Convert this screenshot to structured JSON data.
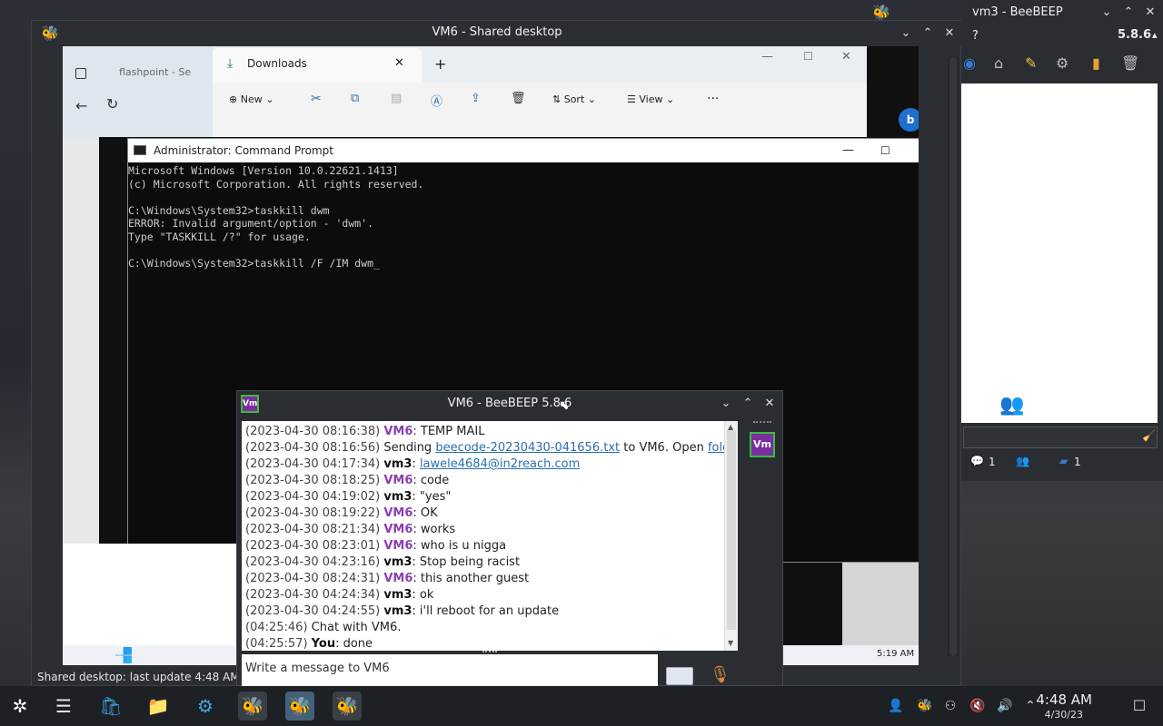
{
  "shared_desktop": {
    "title": "VM6 - Shared desktop",
    "status": "Shared desktop: last update 4:48 AM"
  },
  "remote": {
    "downloads_tab": "Downloads",
    "behind_tab": "flashpoint - Se",
    "toolbar": {
      "new": "New",
      "sort": "Sort",
      "view": "View"
    },
    "cmd_title": "Administrator: Command Prompt",
    "cmd_lines": [
      "Microsoft Windows [Version 10.0.22621.1413]",
      "(c) Microsoft Corporation. All rights reserved.",
      "",
      "C:\\Windows\\System32>taskkill dwm",
      "ERROR: Invalid argument/option - 'dwm'.",
      "Type \"TASKKILL /?\" for usage.",
      "",
      "C:\\Windows\\System32>taskkill /F /IM dwm_"
    ],
    "clock": "5:19 AM"
  },
  "chat": {
    "title": "VM6 - BeeBEEP 5.8.6",
    "badge": "Vm",
    "input_placeholder": "Write a message to VM6",
    "messages": [
      {
        "ts": "(2023-04-30 08:16:38)",
        "who": "VM6",
        "text": ": TEMP MAIL"
      },
      {
        "ts": "(2023-04-30 08:16:56)",
        "who": "",
        "text": " Sending ",
        "link": "beecode-20230430-041656.txt",
        "after": " to VM6. Open ",
        "link2": "folder",
        "tail": "."
      },
      {
        "ts": "(2023-04-30 04:17:34)",
        "who": "vm3",
        "text": ": ",
        "link": "lawele4684@in2reach.com"
      },
      {
        "ts": "(2023-04-30 08:18:25)",
        "who": "VM6",
        "text": ": code"
      },
      {
        "ts": "(2023-04-30 04:19:02)",
        "who": "vm3",
        "text": ": \"yes\""
      },
      {
        "ts": "(2023-04-30 08:19:22)",
        "who": "VM6",
        "text": ": OK"
      },
      {
        "ts": "(2023-04-30 08:21:34)",
        "who": "VM6",
        "text": ": works"
      },
      {
        "ts": "(2023-04-30 08:23:01)",
        "who": "VM6",
        "text": ": who is u nigga"
      },
      {
        "ts": "(2023-04-30 04:23:16)",
        "who": "vm3",
        "text": ": Stop being racist"
      },
      {
        "ts": "(2023-04-30 08:24:31)",
        "who": "VM6",
        "text": ": this another guest"
      },
      {
        "ts": "(2023-04-30 04:24:34)",
        "who": "vm3",
        "text": ": ok"
      },
      {
        "ts": "(2023-04-30 04:24:55)",
        "who": "vm3",
        "text": ": i'll reboot for an update"
      },
      {
        "ts": "(04:25:46)",
        "who": "",
        "text": " Chat with VM6."
      },
      {
        "ts": "(04:25:57)",
        "who": "You",
        "text": ": done"
      }
    ]
  },
  "vm3": {
    "title": "vm3 - BeeBEEP",
    "help": "?",
    "version": "5.8.6",
    "chat_count": "1",
    "msg_count": "1"
  },
  "taskbar": {
    "time": "4:48 AM",
    "date": "4/30/23"
  }
}
